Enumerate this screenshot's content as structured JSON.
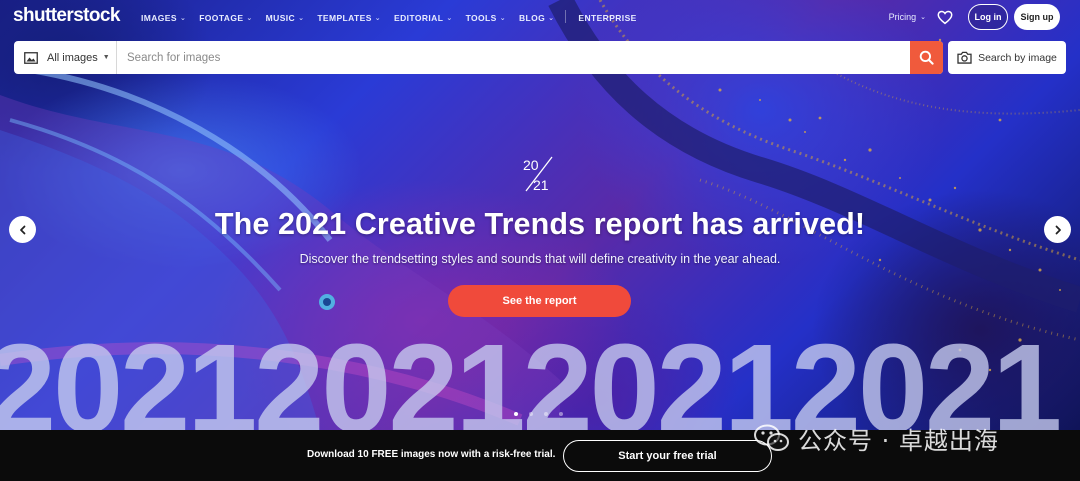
{
  "brand": {
    "logo_text": "shutterstock"
  },
  "nav": {
    "items": [
      {
        "label": "IMAGES",
        "has_menu": true
      },
      {
        "label": "FOOTAGE",
        "has_menu": true
      },
      {
        "label": "MUSIC",
        "has_menu": true
      },
      {
        "label": "TEMPLATES",
        "has_menu": true
      },
      {
        "label": "EDITORIAL",
        "has_menu": true
      },
      {
        "label": "TOOLS",
        "has_menu": true
      },
      {
        "label": "BLOG",
        "has_menu": true
      }
    ],
    "enterprise": "ENTERPRISE",
    "pricing": "Pricing",
    "login": "Log in",
    "signup": "Sign up",
    "icons": [
      "chevron-down-icon",
      "heart-icon"
    ]
  },
  "search": {
    "type_label": "All images",
    "placeholder": "Search for images",
    "value": "",
    "search_by_image": "Search by image",
    "icons": [
      "image-icon",
      "search-icon",
      "camera-icon"
    ]
  },
  "hero": {
    "mark_text": "2021",
    "headline": "The 2021 Creative Trends report has arrived!",
    "subhead": "Discover the trendsetting styles and sounds that will define creativity in the year ahead.",
    "cta": "See the report",
    "big_text": "2021202120212021",
    "carousel": {
      "slides": 4,
      "active_index": 0
    },
    "icons": [
      "chevron-left-icon",
      "chevron-right-icon"
    ]
  },
  "banner": {
    "text": "Download 10 FREE images now with a risk-free trial.",
    "cta": "Start your free trial"
  },
  "watermark": {
    "text": "公众号 · 卓越出海",
    "icon": "wechat-icon"
  },
  "colors": {
    "accent": "#f04a3b",
    "search_button": "#f05a3c",
    "banner_bg": "#0b0b0b"
  }
}
